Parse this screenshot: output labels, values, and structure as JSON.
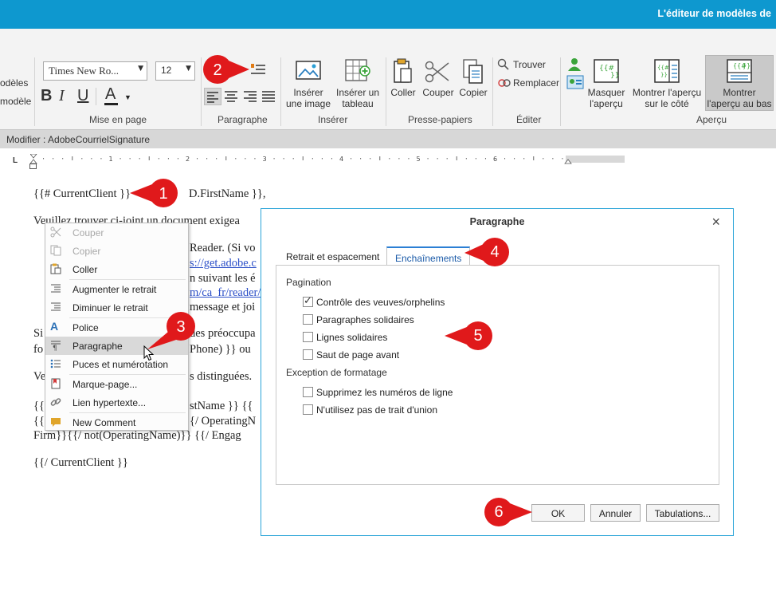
{
  "app": {
    "title": "L'éditeur de modèles de"
  },
  "ribbon": {
    "left_partial": [
      "odèles",
      "modèle"
    ],
    "font_name": "Times New Ro...",
    "font_size": "12",
    "groups": {
      "mise_en_page": "Mise en page",
      "paragraphe": "Paragraphe",
      "inserer": "Insérer",
      "presse_papiers": "Presse-papiers",
      "editer": "Éditer",
      "apercu": "Aperçu"
    },
    "buttons": {
      "inserer_image": [
        "Insérer",
        "une image"
      ],
      "inserer_tableau": [
        "Insérer un",
        "tableau"
      ],
      "coller": "Coller",
      "couper": "Couper",
      "copier": "Copier",
      "trouver": "Trouver",
      "remplacer": "Remplacer",
      "masquer_apercu": [
        "Masquer",
        "l'aperçu"
      ],
      "montrer_cote": [
        "Montrer l'aperçu",
        "sur le côté"
      ],
      "montrer_bas": [
        "Montrer",
        "l'aperçu au bas"
      ]
    }
  },
  "modifier_bar": "Modifier : AdobeCourrielSignature",
  "ruler": {
    "numbers": [
      "1",
      "2",
      "3",
      "4",
      "5",
      "6",
      "7"
    ]
  },
  "document": {
    "line1_a": "{{# CurrentClient }}",
    "line1_b": "D.FirstName }},",
    "line2": "Veuillez trouver ci-joint un document exigea",
    "line3": "Reader. (Si vo",
    "line4_link": "s://get.adobe.c",
    "line5": "n suivant les é",
    "line6_link": "m/ca_fr/reader/",
    "line7": "message et joi",
    "line8_a": "Si",
    "line8_b": "des préoccupa",
    "line9_a": "fo",
    "line9_b": "Phone) }} ou",
    "line10_a": "Ve",
    "line10_b": "s distinguées.",
    "line11_a": "{{",
    "line11_b": "stName }} {{",
    "line12_a": "{{",
    "line12_b": "{/ OperatingN",
    "line13": "Firm}}{{/ not(OperatingName)}} {{/ Engag",
    "line14": "{{/ CurrentClient }}"
  },
  "context_menu": {
    "items": [
      {
        "label": "Couper",
        "icon": "scissors-icon",
        "disabled": true
      },
      {
        "label": "Copier",
        "icon": "copy-icon",
        "disabled": true
      },
      {
        "label": "Coller",
        "icon": "paste-icon",
        "disabled": false
      },
      {
        "label": "Augmenter le retrait",
        "icon": "indent-increase-icon",
        "disabled": false
      },
      {
        "label": "Diminuer le retrait",
        "icon": "indent-decrease-icon",
        "disabled": false
      },
      {
        "label": "Police",
        "icon": "font-icon",
        "disabled": false
      },
      {
        "label": "Paragraphe",
        "icon": "paragraph-icon",
        "disabled": false,
        "highlighted": true
      },
      {
        "label": "Puces et numérotation",
        "icon": "bullets-icon",
        "disabled": false
      },
      {
        "label": "Marque-page...",
        "icon": "bookmark-icon",
        "disabled": false
      },
      {
        "label": "Lien hypertexte...",
        "icon": "link-icon",
        "disabled": false
      },
      {
        "label": "New Comment",
        "icon": "comment-icon",
        "disabled": false
      }
    ]
  },
  "dialog": {
    "title": "Paragraphe",
    "close": "×",
    "tabs": [
      "Retrait et espacement",
      "Enchaînements"
    ],
    "active_tab": "Enchaînements",
    "pagination_label": "Pagination",
    "pagination_options": [
      {
        "label": "Contrôle des veuves/orphelins",
        "checked": true
      },
      {
        "label": "Paragraphes solidaires",
        "checked": false
      },
      {
        "label": "Lignes solidaires",
        "checked": false
      },
      {
        "label": "Saut de page avant",
        "checked": false
      }
    ],
    "exception_label": "Exception de formatage",
    "exception_options": [
      {
        "label": "Supprimez les numéros de ligne",
        "checked": false
      },
      {
        "label": "N'utilisez pas de trait d'union",
        "checked": false
      }
    ],
    "buttons": {
      "ok": "OK",
      "cancel": "Annuler",
      "tabs": "Tabulations..."
    }
  },
  "callouts": [
    "1",
    "2",
    "3",
    "4",
    "5",
    "6"
  ],
  "colors": {
    "accent": "#0e98cf",
    "callout": "#e0191b"
  }
}
